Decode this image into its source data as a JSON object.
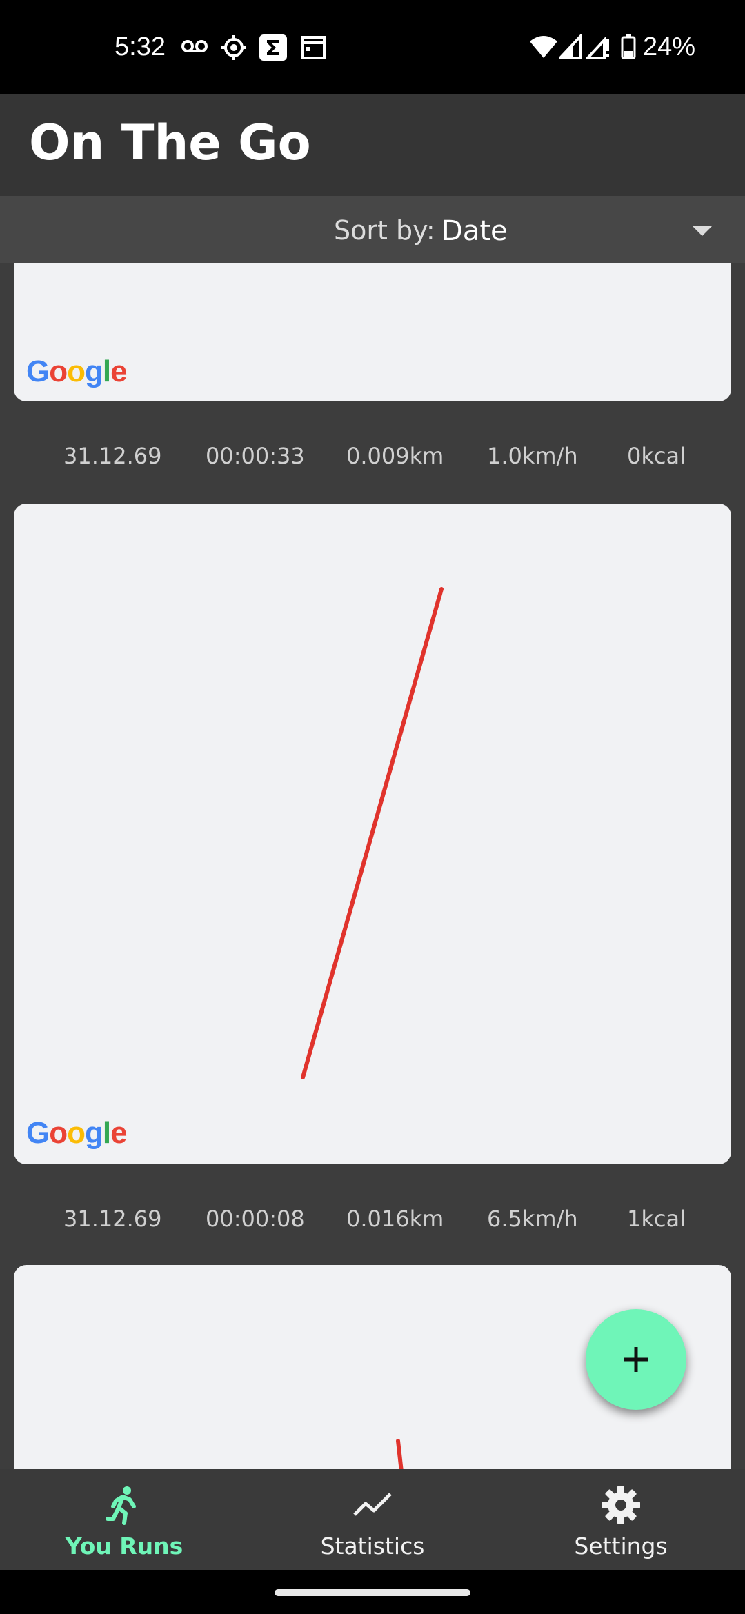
{
  "status_bar": {
    "time": "5:32",
    "left_icons": [
      "voicemail-icon",
      "settings-cog-icon",
      "sigma-app-icon",
      "calendar-icon"
    ],
    "right_icons": [
      "wifi-icon",
      "signal-icon",
      "signal-alert-icon",
      "battery-icon"
    ],
    "battery": "24%"
  },
  "app_bar": {
    "title": "On The Go"
  },
  "sort": {
    "label": "Sort by:",
    "value": "Date"
  },
  "map_attribution": {
    "text": "Google",
    "colors": [
      "#4285F4",
      "#EA4335",
      "#FBBC05",
      "#4285F4",
      "#34A853",
      "#EA4335"
    ]
  },
  "route_color": "#e0332c",
  "runs": [
    {
      "date": "31.12.69",
      "duration": "00:00:33",
      "distance": "0.009km",
      "speed": "1.0km/h",
      "calories": "0kcal"
    },
    {
      "date": "31.12.69",
      "duration": "00:00:08",
      "distance": "0.016km",
      "speed": "6.5km/h",
      "calories": "1kcal"
    }
  ],
  "fab": {
    "icon": "plus-icon",
    "color": "#6ff5b8"
  },
  "bottom_nav": {
    "items": [
      {
        "label": "You Runs",
        "icon": "runner-icon",
        "active": true
      },
      {
        "label": "Statistics",
        "icon": "trend-line-icon",
        "active": false
      },
      {
        "label": "Settings",
        "icon": "gear-icon",
        "active": false
      }
    ],
    "active_color": "#6ff5b8"
  }
}
